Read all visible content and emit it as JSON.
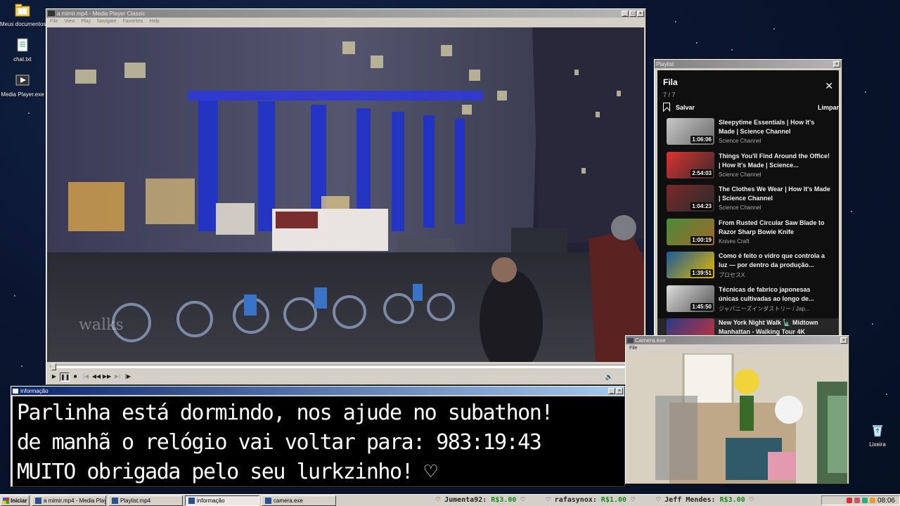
{
  "desktop": {
    "icons": [
      {
        "label": "Meus documentos",
        "icon": "folder-icon"
      },
      {
        "label": "chat.txt",
        "icon": "text-file-icon"
      },
      {
        "label": "Media Player.exe",
        "icon": "media-player-icon"
      },
      {
        "label": "Lixeira",
        "icon": "recycle-bin-icon"
      }
    ]
  },
  "player": {
    "title": "a mimir.mp4 - Media Player Classic",
    "menu": [
      "File",
      "View",
      "Play",
      "Navigate",
      "Favorites",
      "Help"
    ],
    "watermark": "walks"
  },
  "playlist_window": {
    "title": "Playlist",
    "panel_title": "Fila",
    "count": "7 / 7",
    "save_label": "Salvar",
    "clear_label": "Limpar",
    "items": [
      {
        "title": "Sleepytime Essentials | How It's Made | Science Channel",
        "channel": "Science Channel",
        "duration": "1:06:06"
      },
      {
        "title": "Things You'll Find Around the Office! | How It's Made | Science...",
        "channel": "Science Channel",
        "duration": "2:54:03"
      },
      {
        "title": "The Clothes We Wear | How It's Made | Science Channel",
        "channel": "Science Channel",
        "duration": "1:04:23"
      },
      {
        "title": "From Rusted Circular Saw Blade to Razor Sharp Bowie Knife",
        "channel": "Knives Craft",
        "duration": "1:00:19"
      },
      {
        "title": "Como é feito o vidro que controla a luz — por dentro da produção...",
        "channel": "プロセスX",
        "duration": "1:39:51"
      },
      {
        "title": "Técnicas de fabrico japonesas únicas cultivadas ao longo de...",
        "channel": "ジャパニーズインダストリー / Jap...",
        "duration": "1:45:50"
      },
      {
        "title": "New York Night Walk 🗽 Midtown Manhattan - Walking Tour 4K",
        "channel": "",
        "duration": ""
      }
    ]
  },
  "info_window": {
    "title": "informação",
    "lines": [
      "Parlinha está dormindo, nos ajude no subathon!",
      "de manhã o relógio vai voltar para:  983:19:43",
      "MUITO obrigada pelo seu lurkzinho! ♡"
    ]
  },
  "camera_window": {
    "title": "Camera.exe",
    "menu": [
      "File"
    ]
  },
  "taskbar": {
    "start_label": "Iniciar",
    "tasks": [
      {
        "label": "a mimir.mp4 - Media Playe...",
        "active": false
      },
      {
        "label": "Playlist.mp4",
        "active": false
      },
      {
        "label": "informação",
        "active": true
      },
      {
        "label": "camera.exe",
        "active": false
      }
    ],
    "donations": [
      {
        "name": "Jumenta92:",
        "amount": "R$3.00"
      },
      {
        "name": "rafasynox:",
        "amount": "R$1.00"
      },
      {
        "name": "Jeff Mendes:",
        "amount": "R$3.00"
      }
    ],
    "clock": "08:06"
  },
  "colors": {
    "titlebar_active": "#0a246a",
    "window_face": "#d4d0c8",
    "donation_amount": "#1a8a1a",
    "playlist_bg": "#0f0f0f"
  }
}
